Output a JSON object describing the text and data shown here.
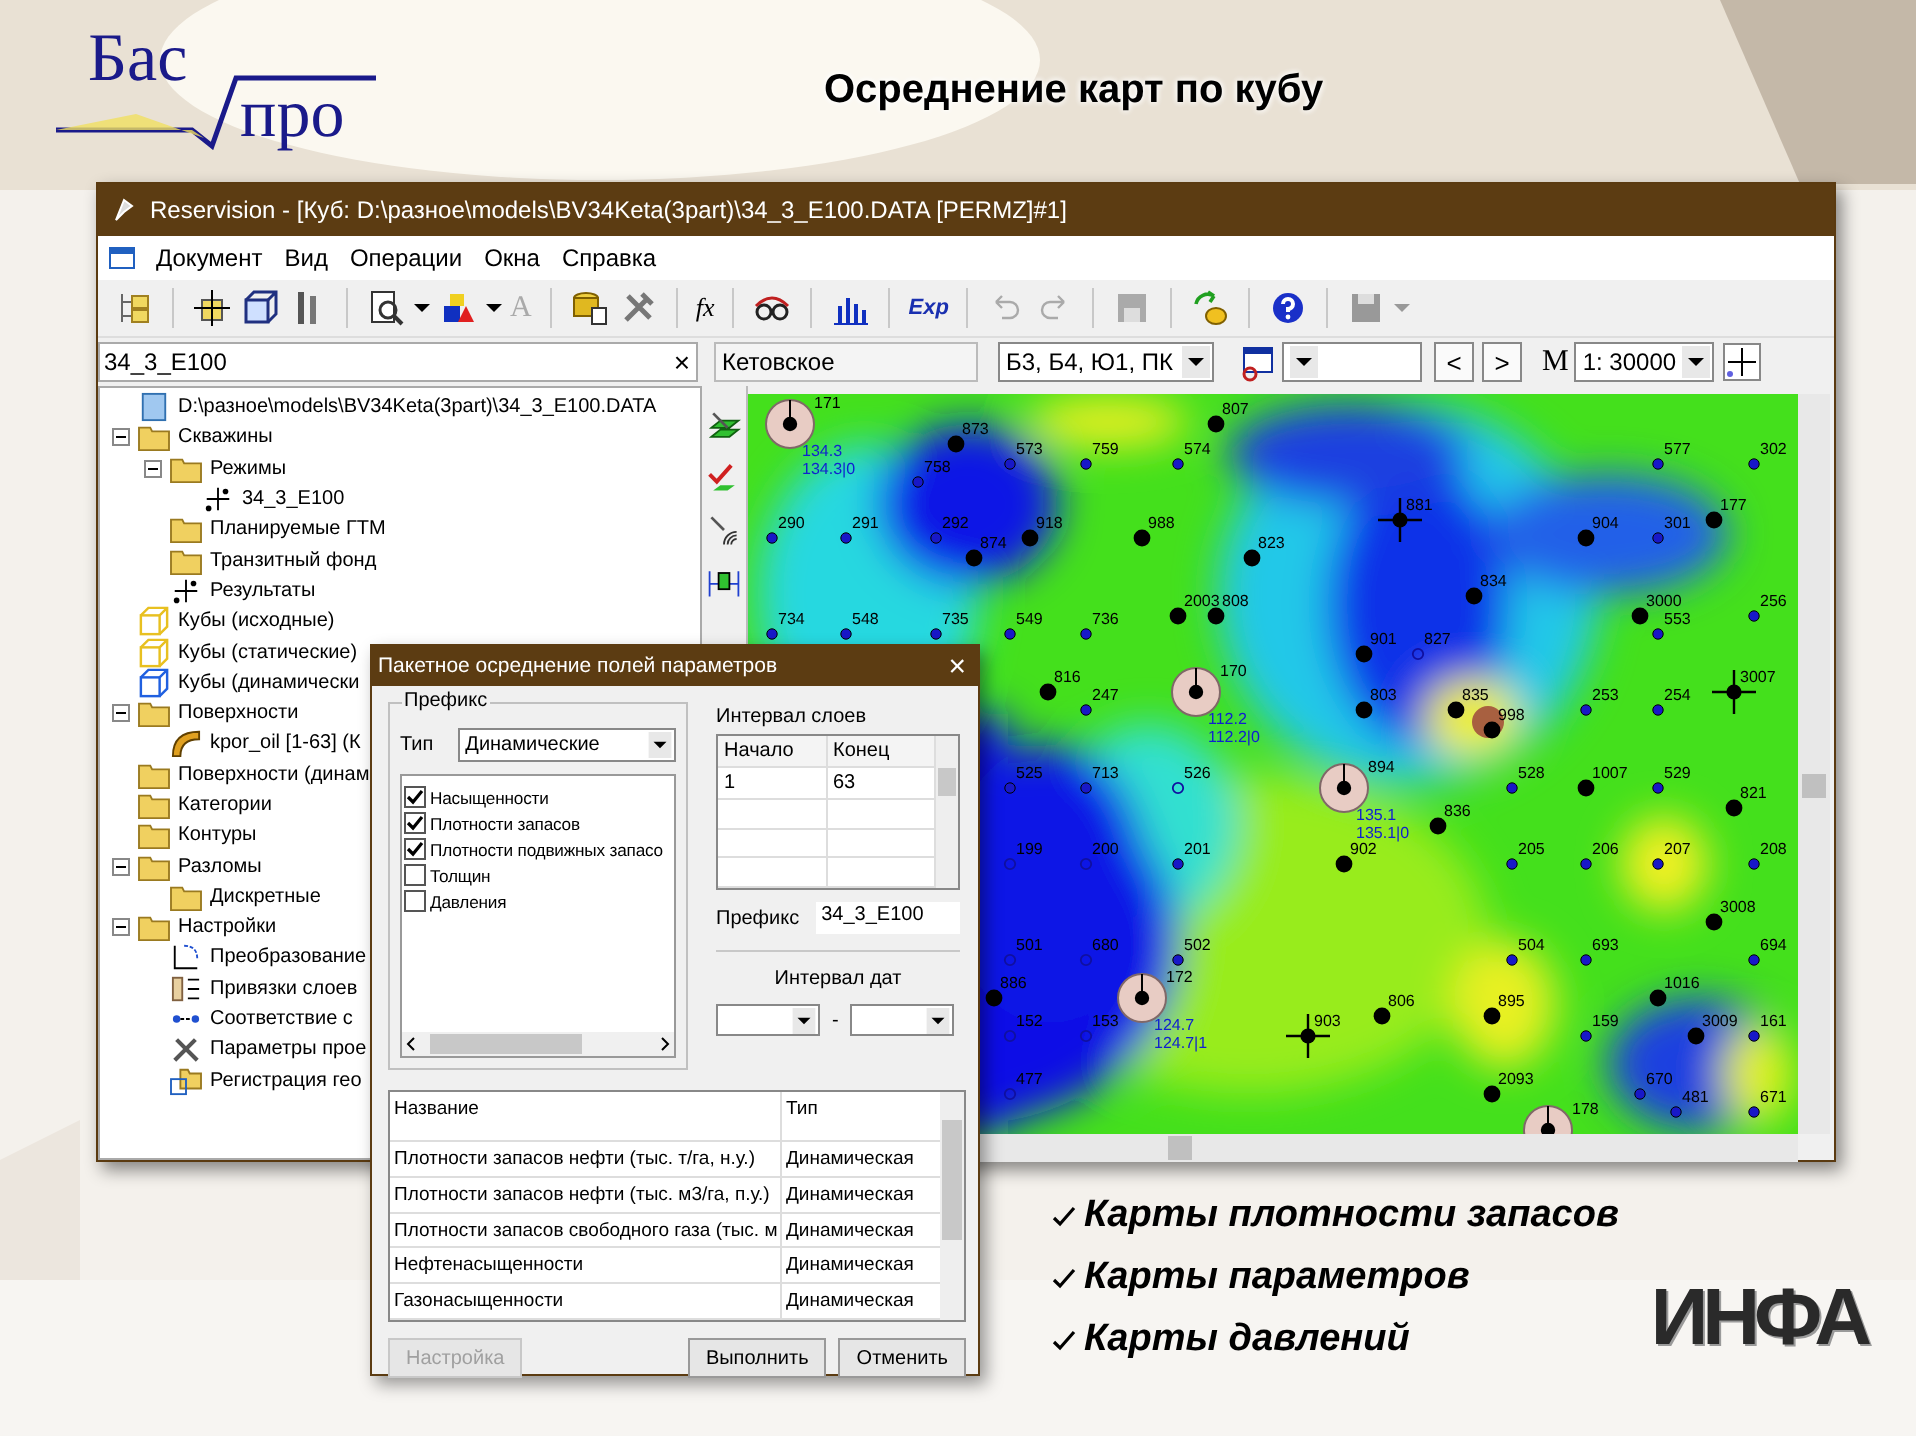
{
  "slide": {
    "logo_top": "Бас",
    "logo_bottom": "про",
    "title": "Осреднение карт по кубу",
    "bullets": [
      "Карты плотности запасов",
      "Карты параметров",
      "Карты давлений"
    ],
    "brand": "ИНФА"
  },
  "window": {
    "title": "Reservision - [Куб: D:\\разное\\models\\BV34Keta(3part)\\34_3_E100.DATA [PERMZ]#1]"
  },
  "menu": [
    "Документ",
    "Вид",
    "Операции",
    "Окна",
    "Справка"
  ],
  "toolbar": {
    "font_glyph": "A",
    "formula_glyph": "fx",
    "export_glyph": "Exp"
  },
  "filters": {
    "search_value": "34_3_E100",
    "clear": "×",
    "field": "Кетовское",
    "layers": "Б3, Б4, Ю1, ПК",
    "prev": "<",
    "next": ">",
    "scale_label": "M",
    "scale": "1:  30000"
  },
  "tree": [
    {
      "label": "D:\\разное\\models\\BV34Keta(3part)\\34_3_E100.DATA",
      "kind": "file"
    },
    {
      "label": "Скважины",
      "kind": "folder",
      "expanded": true,
      "children": [
        {
          "label": "Режимы",
          "kind": "folder",
          "expanded": true,
          "children": [
            {
              "label": "34_3_E100",
              "kind": "wells"
            }
          ]
        },
        {
          "label": "Планируемые ГТМ",
          "kind": "folder"
        },
        {
          "label": "Транзитный фонд",
          "kind": "folder"
        },
        {
          "label": "Результаты",
          "kind": "wells"
        }
      ]
    },
    {
      "label": "Кубы (исходные)",
      "kind": "cube"
    },
    {
      "label": "Кубы (статические)",
      "kind": "cube"
    },
    {
      "label": "Кубы (динамически",
      "kind": "cube_dynamic"
    },
    {
      "label": "Поверхности",
      "kind": "folder",
      "expanded": true,
      "children": [
        {
          "label": "kpor_oil [1-63] (К",
          "kind": "surface"
        }
      ]
    },
    {
      "label": "Поверхности (динам",
      "kind": "folder"
    },
    {
      "label": "Категории",
      "kind": "folder"
    },
    {
      "label": "Контуры",
      "kind": "folder"
    },
    {
      "label": "Разломы",
      "kind": "folder",
      "expanded": true,
      "children": [
        {
          "label": "Дискретные",
          "kind": "folder"
        }
      ]
    },
    {
      "label": "Настройки",
      "kind": "folder",
      "expanded": true,
      "children": [
        {
          "label": "Преобразование",
          "kind": "transform"
        },
        {
          "label": "Привязки слоев",
          "kind": "binding"
        },
        {
          "label": "Соответствие с",
          "kind": "match"
        },
        {
          "label": "Параметры прое",
          "kind": "tools"
        },
        {
          "label": "Регистрация гео",
          "kind": "registration"
        }
      ]
    }
  ],
  "map": {
    "wells": [
      {
        "label": "171",
        "kind": "circle",
        "readings": [
          "134.3",
          "134.3|0"
        ]
      },
      {
        "label": "873",
        "kind": "big"
      },
      {
        "label": "807",
        "kind": "big"
      },
      {
        "label": "573",
        "kind": "small"
      },
      {
        "label": "759",
        "kind": "small"
      },
      {
        "label": "574",
        "kind": "small"
      },
      {
        "label": "577",
        "kind": "small"
      },
      {
        "label": "302",
        "kind": "small"
      },
      {
        "label": "758",
        "kind": "small"
      },
      {
        "label": "290",
        "kind": "small"
      },
      {
        "label": "291",
        "kind": "small"
      },
      {
        "label": "292",
        "kind": "small"
      },
      {
        "label": "874",
        "kind": "big"
      },
      {
        "label": "918",
        "kind": "big"
      },
      {
        "label": "988",
        "kind": "big"
      },
      {
        "label": "823",
        "kind": "big"
      },
      {
        "label": "881",
        "kind": "cross"
      },
      {
        "label": "904",
        "kind": "big"
      },
      {
        "label": "301",
        "kind": "small"
      },
      {
        "label": "177",
        "kind": "big"
      },
      {
        "label": "834",
        "kind": "big"
      },
      {
        "label": "2003",
        "kind": "big"
      },
      {
        "label": "808",
        "kind": "big"
      },
      {
        "label": "3000",
        "kind": "big"
      },
      {
        "label": "553",
        "kind": "small"
      },
      {
        "label": "256",
        "kind": "small"
      },
      {
        "label": "734",
        "kind": "small"
      },
      {
        "label": "548",
        "kind": "small"
      },
      {
        "label": "735",
        "kind": "small"
      },
      {
        "label": "549",
        "kind": "small"
      },
      {
        "label": "736",
        "kind": "small"
      },
      {
        "label": "901",
        "kind": "big"
      },
      {
        "label": "827",
        "kind": "open"
      },
      {
        "label": "816",
        "kind": "big"
      },
      {
        "label": "247",
        "kind": "small"
      },
      {
        "label": "170",
        "kind": "circle",
        "readings": [
          "112.2",
          "112.2|0"
        ]
      },
      {
        "label": "803",
        "kind": "big"
      },
      {
        "label": "835",
        "kind": "big"
      },
      {
        "label": "998",
        "kind": "big"
      },
      {
        "label": "253",
        "kind": "small"
      },
      {
        "label": "254",
        "kind": "small"
      },
      {
        "label": "3007",
        "kind": "cross"
      },
      {
        "label": "525",
        "kind": "small"
      },
      {
        "label": "713",
        "kind": "small"
      },
      {
        "label": "526",
        "kind": "open"
      },
      {
        "label": "894",
        "kind": "circle",
        "readings": [
          "135.1",
          "135.1|0"
        ]
      },
      {
        "label": "528",
        "kind": "small"
      },
      {
        "label": "1007",
        "kind": "big"
      },
      {
        "label": "529",
        "kind": "small"
      },
      {
        "label": "821",
        "kind": "big"
      },
      {
        "label": "836",
        "kind": "big"
      },
      {
        "label": "199",
        "kind": "open"
      },
      {
        "label": "200",
        "kind": "open"
      },
      {
        "label": "201",
        "kind": "small"
      },
      {
        "label": "902",
        "kind": "big"
      },
      {
        "label": "205",
        "kind": "small"
      },
      {
        "label": "206",
        "kind": "small"
      },
      {
        "label": "207",
        "kind": "small"
      },
      {
        "label": "208",
        "kind": "small"
      },
      {
        "label": "3008",
        "kind": "big"
      },
      {
        "label": "501",
        "kind": "open"
      },
      {
        "label": "680",
        "kind": "open"
      },
      {
        "label": "502",
        "kind": "small"
      },
      {
        "label": "504",
        "kind": "small"
      },
      {
        "label": "693",
        "kind": "small"
      },
      {
        "label": "694",
        "kind": "small"
      },
      {
        "label": "886",
        "kind": "big"
      },
      {
        "label": "172",
        "kind": "circle",
        "readings": [
          "124.7",
          "124.7|1"
        ]
      },
      {
        "label": "806",
        "kind": "big"
      },
      {
        "label": "895",
        "kind": "big"
      },
      {
        "label": "1016",
        "kind": "big"
      },
      {
        "label": "152",
        "kind": "open"
      },
      {
        "label": "153",
        "kind": "open"
      },
      {
        "label": "903",
        "kind": "cross"
      },
      {
        "label": "159",
        "kind": "small"
      },
      {
        "label": "3009",
        "kind": "big"
      },
      {
        "label": "161",
        "kind": "small"
      },
      {
        "label": "477",
        "kind": "open"
      },
      {
        "label": "2093",
        "kind": "big"
      },
      {
        "label": "670",
        "kind": "small"
      },
      {
        "label": "481",
        "kind": "small"
      },
      {
        "label": "671",
        "kind": "small"
      },
      {
        "label": "178",
        "kind": "circle"
      }
    ]
  },
  "dialog": {
    "title": "Пакетное осреднение полей параметров",
    "close": "×",
    "group_title": "Префикс",
    "type_label": "Тип",
    "type_value": "Динамические",
    "params": [
      {
        "label": "Насыщенности",
        "checked": true
      },
      {
        "label": "Плотности запасов",
        "checked": true
      },
      {
        "label": "Плотности подвижных запасо",
        "checked": true
      },
      {
        "label": "Толщин",
        "checked": false
      },
      {
        "label": "Давления",
        "checked": false
      }
    ],
    "layers_title": "Интервал слоев",
    "layers_columns": [
      "Начало",
      "Конец"
    ],
    "layers_rows": [
      [
        "1",
        "63"
      ]
    ],
    "prefix_label": "Префикс",
    "prefix_value": "34_3_E100",
    "dates_title": "Интервал дат",
    "dates_sep": "-",
    "table_columns": [
      "Название",
      "Тип"
    ],
    "table_rows": [
      [
        "Плотности запасов нефти (тыс. т/га, н.у.)",
        "Динамическая"
      ],
      [
        "Плотности запасов нефти (тыс. м3/га, п.у.)",
        "Динамическая"
      ],
      [
        "Плотности запасов свободного газа (тыс. м",
        "Динамическая"
      ],
      [
        "Нефтенасыщенности",
        "Динамическая"
      ],
      [
        "Газонасыщенности",
        "Динамическая"
      ]
    ],
    "buttons": [
      {
        "label": "Настройка",
        "disabled": true
      },
      {
        "label": "Выполнить",
        "disabled": false
      },
      {
        "label": "Отменить",
        "disabled": false
      }
    ]
  }
}
